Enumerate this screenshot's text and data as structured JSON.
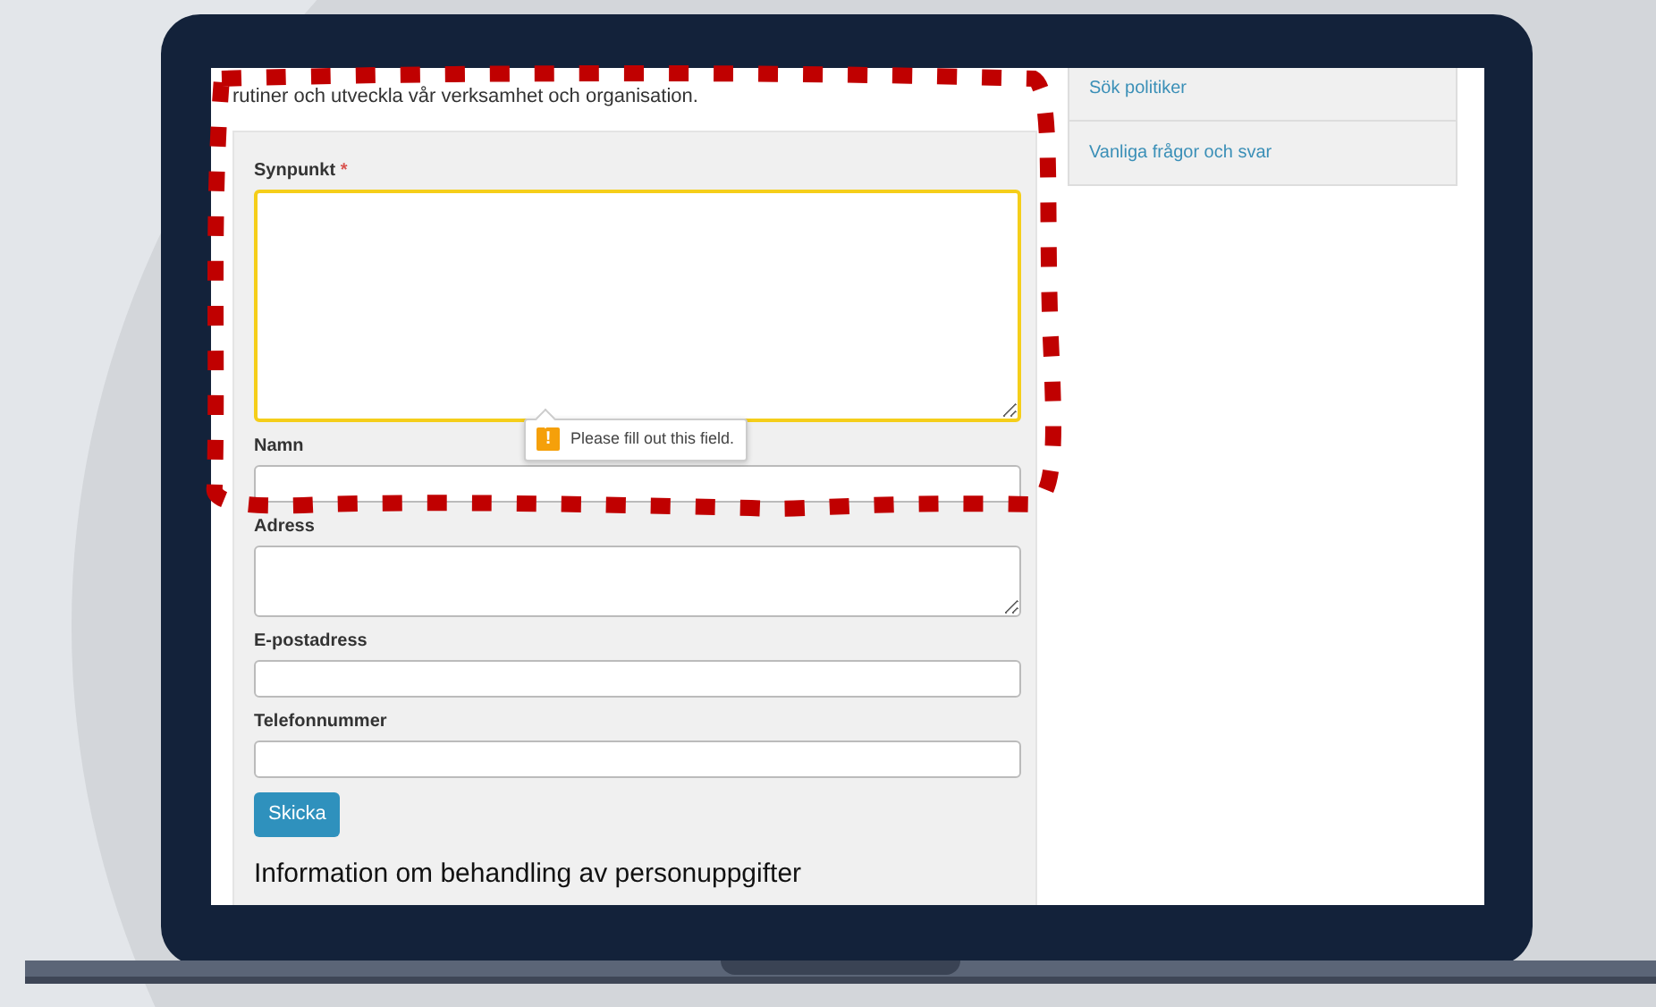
{
  "intro": {
    "lines": [
      "rutiner och utveckla vår verksamhet och organisation."
    ]
  },
  "form": {
    "fields": [
      {
        "label": "Synpunkt",
        "kind": "large-textarea",
        "required": true,
        "focused": true
      },
      {
        "label": "Namn",
        "kind": "input",
        "required": false,
        "focused": false
      },
      {
        "label": "Adress",
        "kind": "textarea",
        "required": false,
        "focused": false
      },
      {
        "label": "E-postadress",
        "kind": "input",
        "required": false,
        "focused": false
      },
      {
        "label": "Telefonnummer",
        "kind": "input",
        "required": false,
        "focused": false
      }
    ],
    "required_mark": "*",
    "submit": "Skicka",
    "tooltip": {
      "icon": "!",
      "text": "Please fill out this field."
    },
    "heading": "Information om behandling av personuppgifter"
  },
  "sidebar": {
    "items": [
      "Sök politiker",
      "Vanliga frågor och svar"
    ]
  },
  "annotation": {
    "kind": "dotted-outline"
  }
}
